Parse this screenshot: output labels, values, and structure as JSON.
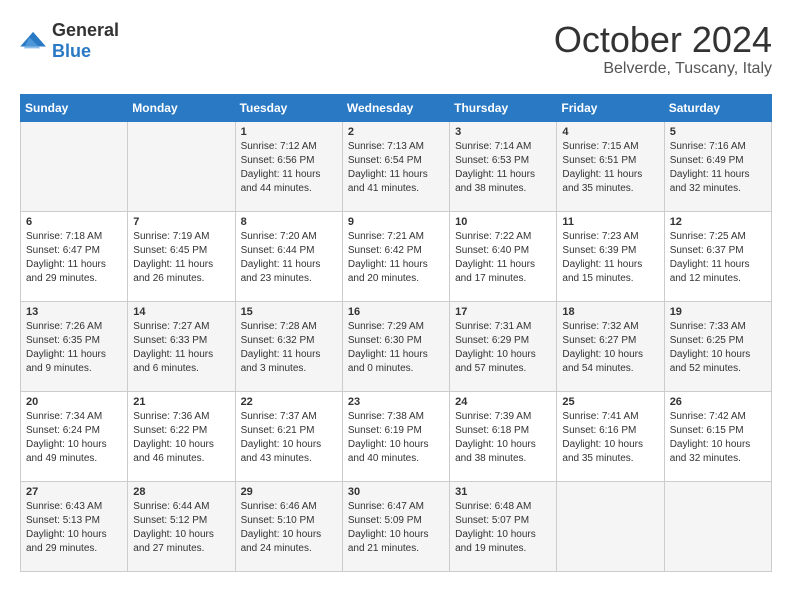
{
  "logo": {
    "general": "General",
    "blue": "Blue"
  },
  "title": "October 2024",
  "location": "Belverde, Tuscany, Italy",
  "days_of_week": [
    "Sunday",
    "Monday",
    "Tuesday",
    "Wednesday",
    "Thursday",
    "Friday",
    "Saturday"
  ],
  "weeks": [
    [
      {
        "num": "",
        "sunrise": "",
        "sunset": "",
        "daylight": ""
      },
      {
        "num": "",
        "sunrise": "",
        "sunset": "",
        "daylight": ""
      },
      {
        "num": "1",
        "sunrise": "Sunrise: 7:12 AM",
        "sunset": "Sunset: 6:56 PM",
        "daylight": "Daylight: 11 hours and 44 minutes."
      },
      {
        "num": "2",
        "sunrise": "Sunrise: 7:13 AM",
        "sunset": "Sunset: 6:54 PM",
        "daylight": "Daylight: 11 hours and 41 minutes."
      },
      {
        "num": "3",
        "sunrise": "Sunrise: 7:14 AM",
        "sunset": "Sunset: 6:53 PM",
        "daylight": "Daylight: 11 hours and 38 minutes."
      },
      {
        "num": "4",
        "sunrise": "Sunrise: 7:15 AM",
        "sunset": "Sunset: 6:51 PM",
        "daylight": "Daylight: 11 hours and 35 minutes."
      },
      {
        "num": "5",
        "sunrise": "Sunrise: 7:16 AM",
        "sunset": "Sunset: 6:49 PM",
        "daylight": "Daylight: 11 hours and 32 minutes."
      }
    ],
    [
      {
        "num": "6",
        "sunrise": "Sunrise: 7:18 AM",
        "sunset": "Sunset: 6:47 PM",
        "daylight": "Daylight: 11 hours and 29 minutes."
      },
      {
        "num": "7",
        "sunrise": "Sunrise: 7:19 AM",
        "sunset": "Sunset: 6:45 PM",
        "daylight": "Daylight: 11 hours and 26 minutes."
      },
      {
        "num": "8",
        "sunrise": "Sunrise: 7:20 AM",
        "sunset": "Sunset: 6:44 PM",
        "daylight": "Daylight: 11 hours and 23 minutes."
      },
      {
        "num": "9",
        "sunrise": "Sunrise: 7:21 AM",
        "sunset": "Sunset: 6:42 PM",
        "daylight": "Daylight: 11 hours and 20 minutes."
      },
      {
        "num": "10",
        "sunrise": "Sunrise: 7:22 AM",
        "sunset": "Sunset: 6:40 PM",
        "daylight": "Daylight: 11 hours and 17 minutes."
      },
      {
        "num": "11",
        "sunrise": "Sunrise: 7:23 AM",
        "sunset": "Sunset: 6:39 PM",
        "daylight": "Daylight: 11 hours and 15 minutes."
      },
      {
        "num": "12",
        "sunrise": "Sunrise: 7:25 AM",
        "sunset": "Sunset: 6:37 PM",
        "daylight": "Daylight: 11 hours and 12 minutes."
      }
    ],
    [
      {
        "num": "13",
        "sunrise": "Sunrise: 7:26 AM",
        "sunset": "Sunset: 6:35 PM",
        "daylight": "Daylight: 11 hours and 9 minutes."
      },
      {
        "num": "14",
        "sunrise": "Sunrise: 7:27 AM",
        "sunset": "Sunset: 6:33 PM",
        "daylight": "Daylight: 11 hours and 6 minutes."
      },
      {
        "num": "15",
        "sunrise": "Sunrise: 7:28 AM",
        "sunset": "Sunset: 6:32 PM",
        "daylight": "Daylight: 11 hours and 3 minutes."
      },
      {
        "num": "16",
        "sunrise": "Sunrise: 7:29 AM",
        "sunset": "Sunset: 6:30 PM",
        "daylight": "Daylight: 11 hours and 0 minutes."
      },
      {
        "num": "17",
        "sunrise": "Sunrise: 7:31 AM",
        "sunset": "Sunset: 6:29 PM",
        "daylight": "Daylight: 10 hours and 57 minutes."
      },
      {
        "num": "18",
        "sunrise": "Sunrise: 7:32 AM",
        "sunset": "Sunset: 6:27 PM",
        "daylight": "Daylight: 10 hours and 54 minutes."
      },
      {
        "num": "19",
        "sunrise": "Sunrise: 7:33 AM",
        "sunset": "Sunset: 6:25 PM",
        "daylight": "Daylight: 10 hours and 52 minutes."
      }
    ],
    [
      {
        "num": "20",
        "sunrise": "Sunrise: 7:34 AM",
        "sunset": "Sunset: 6:24 PM",
        "daylight": "Daylight: 10 hours and 49 minutes."
      },
      {
        "num": "21",
        "sunrise": "Sunrise: 7:36 AM",
        "sunset": "Sunset: 6:22 PM",
        "daylight": "Daylight: 10 hours and 46 minutes."
      },
      {
        "num": "22",
        "sunrise": "Sunrise: 7:37 AM",
        "sunset": "Sunset: 6:21 PM",
        "daylight": "Daylight: 10 hours and 43 minutes."
      },
      {
        "num": "23",
        "sunrise": "Sunrise: 7:38 AM",
        "sunset": "Sunset: 6:19 PM",
        "daylight": "Daylight: 10 hours and 40 minutes."
      },
      {
        "num": "24",
        "sunrise": "Sunrise: 7:39 AM",
        "sunset": "Sunset: 6:18 PM",
        "daylight": "Daylight: 10 hours and 38 minutes."
      },
      {
        "num": "25",
        "sunrise": "Sunrise: 7:41 AM",
        "sunset": "Sunset: 6:16 PM",
        "daylight": "Daylight: 10 hours and 35 minutes."
      },
      {
        "num": "26",
        "sunrise": "Sunrise: 7:42 AM",
        "sunset": "Sunset: 6:15 PM",
        "daylight": "Daylight: 10 hours and 32 minutes."
      }
    ],
    [
      {
        "num": "27",
        "sunrise": "Sunrise: 6:43 AM",
        "sunset": "Sunset: 5:13 PM",
        "daylight": "Daylight: 10 hours and 29 minutes."
      },
      {
        "num": "28",
        "sunrise": "Sunrise: 6:44 AM",
        "sunset": "Sunset: 5:12 PM",
        "daylight": "Daylight: 10 hours and 27 minutes."
      },
      {
        "num": "29",
        "sunrise": "Sunrise: 6:46 AM",
        "sunset": "Sunset: 5:10 PM",
        "daylight": "Daylight: 10 hours and 24 minutes."
      },
      {
        "num": "30",
        "sunrise": "Sunrise: 6:47 AM",
        "sunset": "Sunset: 5:09 PM",
        "daylight": "Daylight: 10 hours and 21 minutes."
      },
      {
        "num": "31",
        "sunrise": "Sunrise: 6:48 AM",
        "sunset": "Sunset: 5:07 PM",
        "daylight": "Daylight: 10 hours and 19 minutes."
      },
      {
        "num": "",
        "sunrise": "",
        "sunset": "",
        "daylight": ""
      },
      {
        "num": "",
        "sunrise": "",
        "sunset": "",
        "daylight": ""
      }
    ]
  ]
}
